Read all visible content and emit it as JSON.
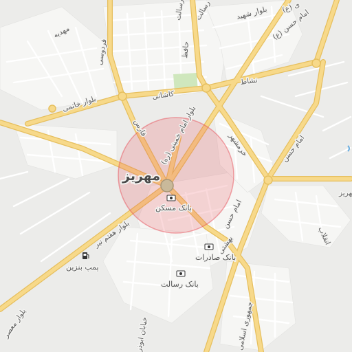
{
  "map": {
    "city_name": "مهریز",
    "city_name_east": "مهریز",
    "search_radius_color": "#e8505a",
    "colors": {
      "background": "#ececea",
      "block": "#f7f7f5",
      "major_road": "#f7d98a",
      "major_road_casing": "#e6bf5e",
      "minor_road": "#ffffff",
      "park": "#cfe7bd",
      "water": "#b7d6ee"
    }
  },
  "streets": {
    "mahdieh": "مهدیه",
    "ferdowsi": "فردوسی",
    "hafez": "حافظ",
    "resalat_1": "رسالت",
    "resalat_2": "رسالت",
    "boulevard_shahid": "بلوار شهید",
    "imam_hasan_r": "امام حسن (ع)",
    "imam_hasan_1": "امام حسن",
    "imam_hasan_2": "امام حسن",
    "imam_hasan_3": "امام حسن",
    "boulevard_khatami": "بلوار خاتمی",
    "kashani": "کاشانی",
    "neshat": "نشاط",
    "boulevard_imam_khomeini": "بلوار امام خمینی (ره)",
    "fars": "فارس",
    "khorramshahr": "خرمشهر",
    "boulevard_haftom_tir": "بلوار هفتم تیر",
    "beheshti": "بهشتی",
    "enghelab": "انقلاب",
    "khiaban_abouzar": "خیابان ابوذر",
    "jomhouri_eslami": "جمهوری اسلامی",
    "boulevard_moaser": "بلوار معصر",
    "imam_r_top": "ی (ع)"
  },
  "pois": {
    "bank_maskan": "بانک مسکن",
    "bank_saderat": "بانک صادرات",
    "bank_resalat": "بانک رسالت",
    "gas_station": "پمپ بنزین"
  },
  "icons": {
    "bank": "bank-icon",
    "fuel": "fuel-pump-icon",
    "city_center": "city-center-marker"
  }
}
